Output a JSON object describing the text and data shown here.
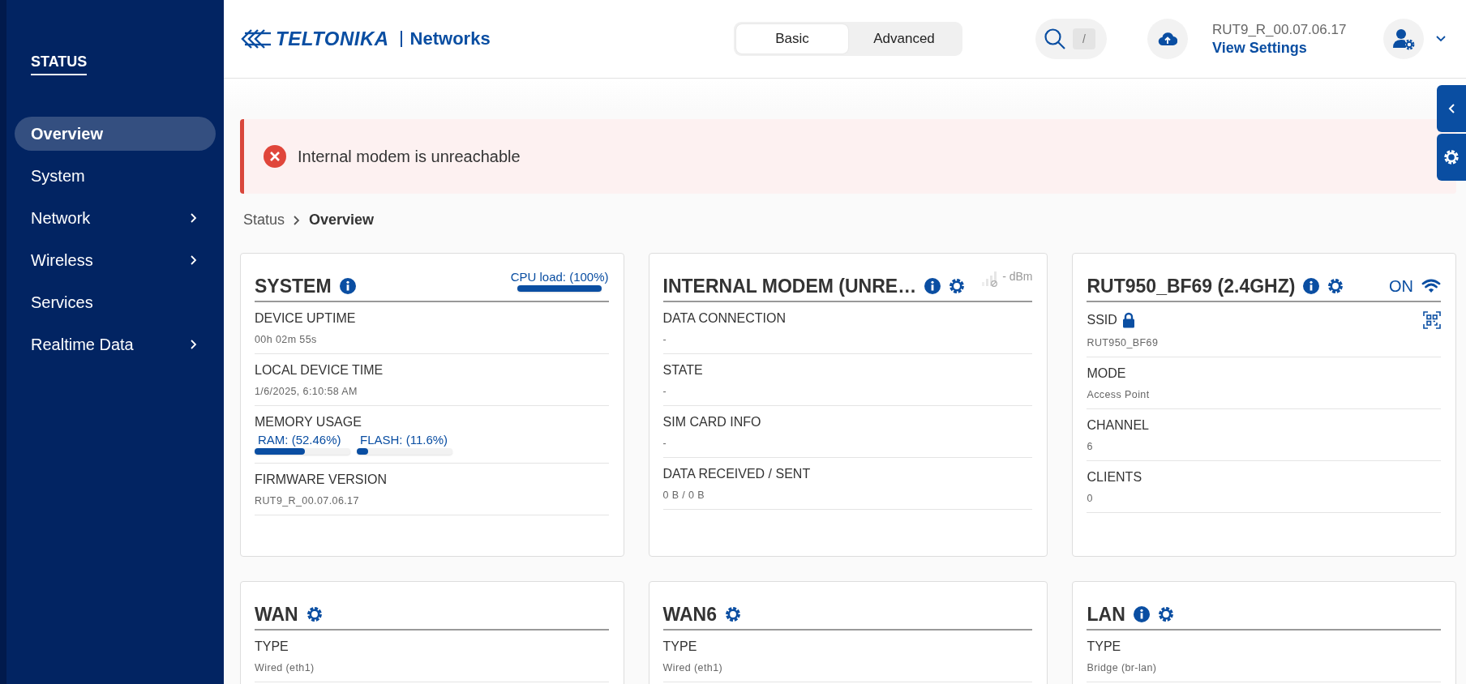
{
  "sidebar": {
    "heading": "STATUS",
    "items": [
      {
        "label": "Overview",
        "selected": true,
        "has_submenu": false
      },
      {
        "label": "System",
        "selected": false,
        "has_submenu": false
      },
      {
        "label": "Network",
        "selected": false,
        "has_submenu": true
      },
      {
        "label": "Wireless",
        "selected": false,
        "has_submenu": true
      },
      {
        "label": "Services",
        "selected": false,
        "has_submenu": false
      },
      {
        "label": "Realtime Data",
        "selected": false,
        "has_submenu": true
      }
    ]
  },
  "header": {
    "logo_word": "TELTONIKA",
    "logo_suffix": "Networks",
    "mode_tabs": [
      {
        "label": "Basic",
        "selected": true
      },
      {
        "label": "Advanced",
        "selected": false
      }
    ],
    "search_shortcut": "/",
    "firmware": "RUT9_R_00.07.06.17",
    "settings_link": "View Settings"
  },
  "alert": {
    "message": "Internal modem is unreachable"
  },
  "breadcrumb": [
    "Status",
    "Overview"
  ],
  "cards": [
    {
      "title": "SYSTEM",
      "has_info": true,
      "has_settings": false,
      "header_meter": {
        "label": "CPU load: (100%)",
        "level": 1
      },
      "rows": [
        {
          "kind": "text",
          "label": "DEVICE UPTIME",
          "value": "00h 02m 55s"
        },
        {
          "kind": "text",
          "label": "LOCAL DEVICE TIME",
          "value": "1/6/2025, 6:10:58 AM"
        },
        {
          "kind": "meters",
          "label": "MEMORY USAGE",
          "meters": [
            {
              "label": "RAM: (52.46%)",
              "level": 0.5246
            },
            {
              "label": "FLASH: (11.6%)",
              "level": 0.116
            }
          ]
        },
        {
          "kind": "text",
          "label": "FIRMWARE VERSION",
          "value": "RUT9_R_00.07.06.17"
        }
      ]
    },
    {
      "title": "INTERNAL MODEM (UNRE…",
      "has_info": true,
      "has_settings": true,
      "signal": {
        "reading": "- dBm"
      },
      "rows": [
        {
          "kind": "text",
          "label": "DATA CONNECTION",
          "value": "-"
        },
        {
          "kind": "text",
          "label": "STATE",
          "value": "-"
        },
        {
          "kind": "text",
          "label": "SIM CARD INFO",
          "value": "-"
        },
        {
          "kind": "text",
          "label": "DATA RECEIVED / SENT",
          "value": "0 B / 0 B"
        }
      ]
    },
    {
      "title": "RUT950_BF69 (2.4GHZ)",
      "has_info": true,
      "has_settings": true,
      "status": {
        "label": "ON"
      },
      "rows": [
        {
          "kind": "ssid",
          "label": "SSID",
          "value": "RUT950_BF69",
          "locked": true,
          "qr_button": true
        },
        {
          "kind": "text",
          "label": "MODE",
          "value": "Access Point"
        },
        {
          "kind": "text",
          "label": "CHANNEL",
          "value": "6"
        },
        {
          "kind": "text",
          "label": "CLIENTS",
          "value": "0"
        }
      ]
    },
    {
      "title": "WAN",
      "has_info": false,
      "has_settings": true,
      "rows": [
        {
          "kind": "text",
          "label": "TYPE",
          "value": "Wired (eth1)"
        }
      ]
    },
    {
      "title": "WAN6",
      "has_info": false,
      "has_settings": true,
      "rows": [
        {
          "kind": "text",
          "label": "TYPE",
          "value": "Wired (eth1)"
        }
      ]
    },
    {
      "title": "LAN",
      "has_info": true,
      "has_settings": true,
      "rows": [
        {
          "kind": "text",
          "label": "TYPE",
          "value": "Bridge (br-lan)"
        }
      ]
    }
  ]
}
